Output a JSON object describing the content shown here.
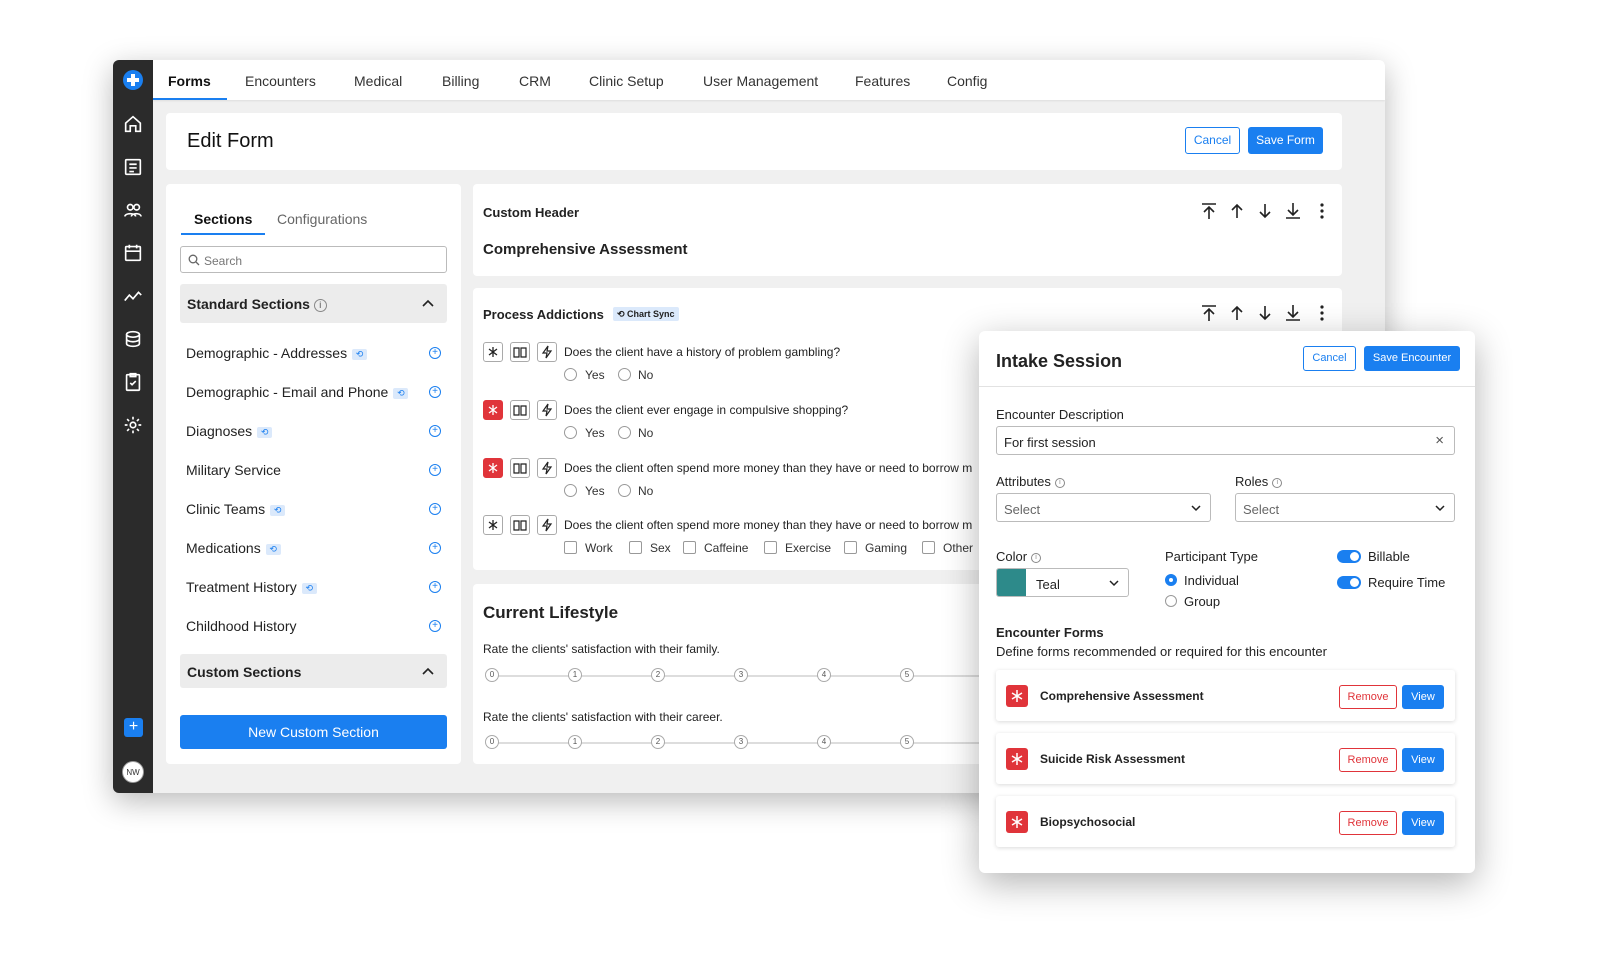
{
  "nav": {
    "tabs": [
      "Forms",
      "Encounters",
      "Medical",
      "Billing",
      "CRM",
      "Clinic Setup",
      "User Management",
      "Features",
      "Config"
    ]
  },
  "rail": {
    "avatar": "NW",
    "plus": "+"
  },
  "header": {
    "title": "Edit Form",
    "cancel": "Cancel",
    "save": "Save Form"
  },
  "left_panel": {
    "tabs": [
      "Sections",
      "Configurations"
    ],
    "search_placeholder": "Search",
    "standard_title": "Standard Sections",
    "standard_items": [
      "Demographic - Addresses",
      "Demographic - Email and Phone",
      "Diagnoses",
      "Military Service",
      "Clinic Teams",
      "Medications",
      "Treatment History",
      "Childhood History"
    ],
    "custom_title": "Custom Sections",
    "new_button": "New Custom Section"
  },
  "custom_header": {
    "label": "Custom Header",
    "value": "Comprehensive Assessment"
  },
  "process": {
    "title": "Process Addictions",
    "badge": "Chart Sync",
    "questions": [
      "Does the client have a history of problem gambling?",
      "Does the client ever engage in compulsive shopping?",
      "Does the client often spend more money than they have or need to borrow m",
      "Does the client often spend more money than they have or need to borrow m"
    ],
    "yes": "Yes",
    "no": "No",
    "checks": [
      "Work",
      "Sex",
      "Caffeine",
      "Exercise",
      "Gaming",
      "Other"
    ]
  },
  "lifestyle": {
    "title": "Current Lifestyle",
    "q1": "Rate the clients' satisfaction with their family.",
    "q2": "Rate the clients' satisfaction with their career.",
    "scale": [
      "0",
      "1",
      "2",
      "3",
      "4",
      "5"
    ]
  },
  "modal": {
    "title": "Intake Session",
    "cancel": "Cancel",
    "save": "Save Encounter",
    "desc_label": "Encounter Description",
    "desc_value": "For first session",
    "clear": "×",
    "attributes_label": "Attributes",
    "roles_label": "Roles",
    "select_placeholder": "Select",
    "color_label": "Color",
    "color_value": "Teal",
    "color_hex": "#2d8a8a",
    "ptype_label": "Participant Type",
    "ptype_options": [
      "Individual",
      "Group"
    ],
    "billable": "Billable",
    "require_time": "Require Time",
    "forms_title": "Encounter Forms",
    "forms_desc": "Define forms recommended or required for this encounter",
    "forms": [
      "Comprehensive Assessment",
      "Suicide Risk Assessment",
      "Biopsychosocial"
    ],
    "remove": "Remove",
    "view": "View"
  },
  "colors": {
    "accent": "#1a7ff0",
    "danger": "#e0343a",
    "rail": "#2b2b2b"
  }
}
